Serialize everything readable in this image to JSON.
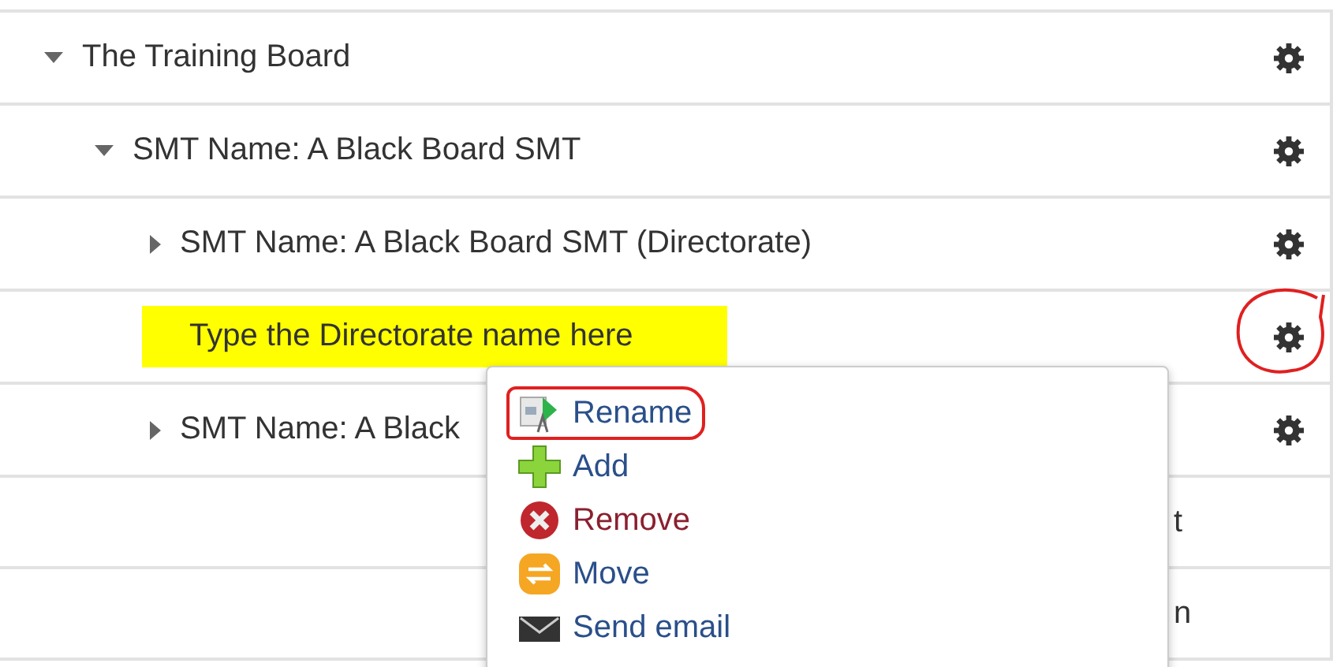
{
  "tree": [
    {
      "label": "The Training Board",
      "kind": "branch",
      "expanded": true,
      "highlighted": false,
      "gear_circled": false,
      "children": [
        {
          "label": "SMT Name: A Black Board SMT",
          "kind": "branch",
          "expanded": true,
          "highlighted": false,
          "gear_circled": false,
          "children": [
            {
              "label": "SMT Name: A Black Board SMT (Directorate)",
              "kind": "branch",
              "expanded": false,
              "highlighted": false,
              "gear_circled": false
            },
            {
              "label": "Type the Directorate name here",
              "kind": "leaf",
              "highlighted": true,
              "gear_circled": true
            },
            {
              "label": "SMT Name: A Black",
              "kind": "branch",
              "expanded": false,
              "highlighted": false,
              "gear_circled": false
            }
          ]
        }
      ]
    }
  ],
  "background_fragments": [
    "t",
    "n"
  ],
  "context_menu": {
    "items": [
      {
        "label": "Rename",
        "kind": "rename",
        "color": "#2a4f8a",
        "circled": true
      },
      {
        "label": "Add",
        "kind": "add",
        "color": "#2a4f8a",
        "circled": false
      },
      {
        "label": "Remove",
        "kind": "remove",
        "color": "#8a2030",
        "circled": false
      },
      {
        "label": "Move",
        "kind": "move",
        "color": "#2a4f8a",
        "circled": false
      },
      {
        "label": "Send email",
        "kind": "email",
        "color": "#2a4f8a",
        "circled": false
      }
    ]
  }
}
